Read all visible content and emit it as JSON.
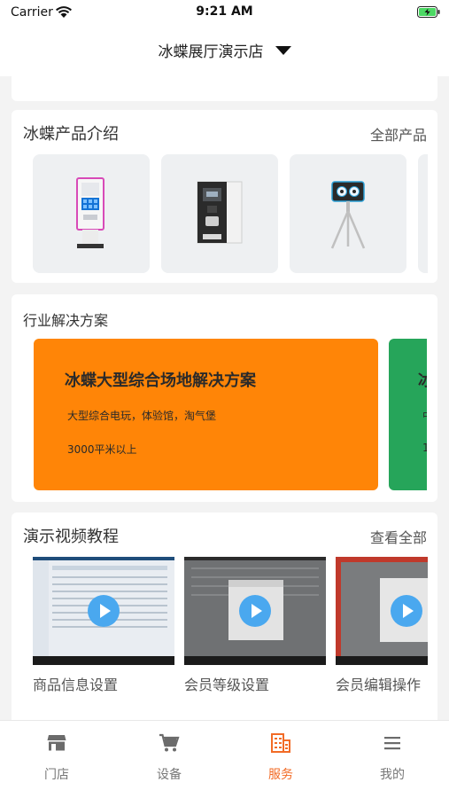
{
  "status_bar": {
    "carrier": "Carrier",
    "time": "9:21 AM"
  },
  "header": {
    "store_name": "冰蝶展厅演示店"
  },
  "products": {
    "title": "冰蝶产品介绍",
    "link": "全部产品",
    "items": [
      {
        "icon": "kiosk-machine-icon"
      },
      {
        "icon": "vending-cabinet-icon"
      },
      {
        "icon": "camera-tripod-icon"
      }
    ]
  },
  "solutions": {
    "title": "行业解决方案",
    "cards": [
      {
        "name": "冰蝶大型综合场地解决方案",
        "desc": "大型综合电玩，体验馆，淘气堡",
        "area": "3000平米以上",
        "color": "#ff8507"
      },
      {
        "name": "冰",
        "desc": "中",
        "area": "1",
        "color": "#26a55a"
      }
    ]
  },
  "videos": {
    "title": "演示视频教程",
    "link": "查看全部",
    "items": [
      {
        "title": "商品信息设置"
      },
      {
        "title": "会员等级设置"
      },
      {
        "title": "会员编辑操作"
      }
    ]
  },
  "tabs": [
    {
      "label": "门店",
      "icon": "store-icon"
    },
    {
      "label": "设备",
      "icon": "cart-icon"
    },
    {
      "label": "服务",
      "icon": "building-icon",
      "active": true
    },
    {
      "label": "我的",
      "icon": "menu-icon"
    }
  ],
  "colors": {
    "accent": "#f26b26",
    "play": "#4aa8ef"
  }
}
